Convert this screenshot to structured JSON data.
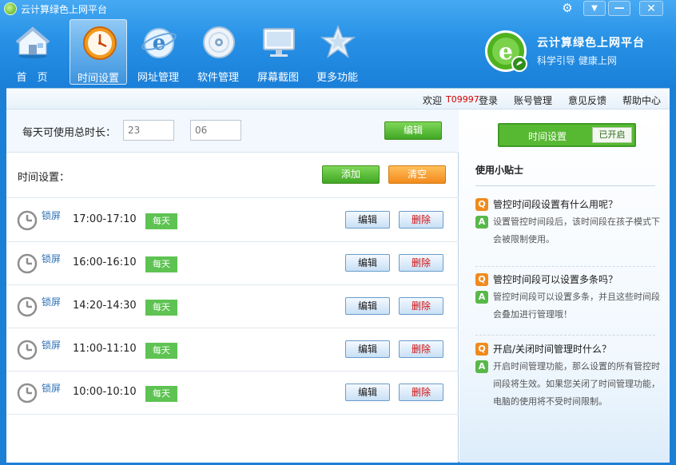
{
  "titlebar": {
    "title": "云计算绿色上网平台"
  },
  "nav": [
    {
      "label": "首　页",
      "icon": "home-icon",
      "active": false
    },
    {
      "label": "时间设置",
      "icon": "clock-icon",
      "active": true
    },
    {
      "label": "网址管理",
      "icon": "browser-icon",
      "active": false
    },
    {
      "label": "软件管理",
      "icon": "disc-icon",
      "active": false
    },
    {
      "label": "屏幕截图",
      "icon": "monitor-icon",
      "active": false
    },
    {
      "label": "更多功能",
      "icon": "star-icon",
      "active": false
    }
  ],
  "brand": {
    "name": "云计算绿色上网平台",
    "slogan": "科学引导  健康上网"
  },
  "toplinks": {
    "welcome": "欢迎",
    "user_id": "T09997",
    "login": "登录",
    "account": "账号管理",
    "feedback": "意见反馈",
    "help": "帮助中心"
  },
  "daily": {
    "label": "每天可使用总时长：",
    "hours_placeholder": "23",
    "minutes_placeholder": "06",
    "edit_label": "编辑"
  },
  "timeset": {
    "label": "时间设置：",
    "add_label": "添加",
    "clear_label": "清空"
  },
  "schedules": [
    {
      "action": "锁屏",
      "range": "17:00-17:10",
      "repeat": "每天",
      "edit": "编辑",
      "delete": "删除"
    },
    {
      "action": "锁屏",
      "range": "16:00-16:10",
      "repeat": "每天",
      "edit": "编辑",
      "delete": "删除"
    },
    {
      "action": "锁屏",
      "range": "14:20-14:30",
      "repeat": "每天",
      "edit": "编辑",
      "delete": "删除"
    },
    {
      "action": "锁屏",
      "range": "11:00-11:10",
      "repeat": "每天",
      "edit": "编辑",
      "delete": "删除"
    },
    {
      "action": "锁屏",
      "range": "10:00-10:10",
      "repeat": "每天",
      "edit": "编辑",
      "delete": "删除"
    }
  ],
  "sidebar": {
    "toggle_label": "时间设置",
    "toggle_state": "已开启",
    "tips_title": "使用小贴士",
    "qa": [
      {
        "q": "管控时间段设置有什么用呢？",
        "a": "设置管控时间段后，该时间段在孩子模式下会被限制使用。"
      },
      {
        "q": "管控时间段可以设置多条吗？",
        "a": "管控时间段可以设置多条，并且这些时间段会叠加进行管理哦！"
      },
      {
        "q": "开启/关闭时间管理时什么？",
        "a": "开启时间管理功能，那么设置的所有管控时间段将生效。如果您关闭了时间管理功能，电脑的使用将不受时间限制。"
      }
    ],
    "q_mark": "Q",
    "a_mark": "A"
  },
  "colors": {
    "header": "#2791e6",
    "accent_green": "#57b932",
    "accent_orange": "#f28a1d",
    "delete_red": "#d01010"
  }
}
